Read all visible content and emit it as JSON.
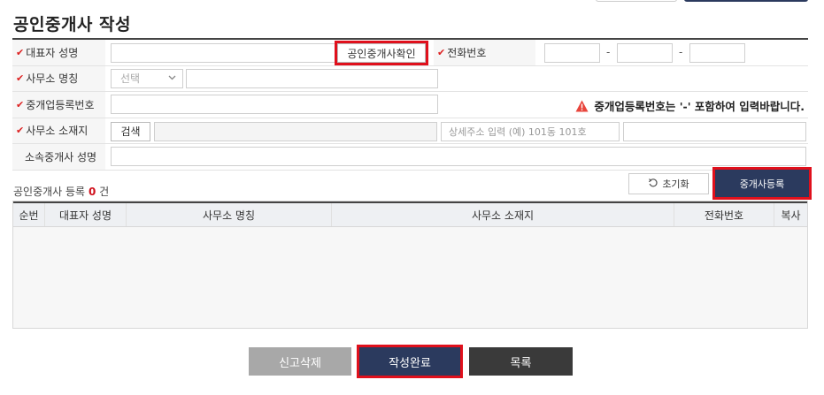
{
  "page": {
    "title": "공인중개사 작성"
  },
  "form": {
    "rep_name_label": "대표자 성명",
    "verify_button": "공인중개사확인",
    "phone_label": "전화번호",
    "phone_sep": "-",
    "office_name_label": "사무소 명칭",
    "office_select_value": "선택",
    "reg_no_label": "중개업등록번호",
    "reg_no_warning": "중개업등록번호는  '-' 포함하여 입력바랍니다.",
    "address_label": "사무소 소재지",
    "search_button": "검색",
    "address_detail_placeholder": "상세주소 입력 (예) 101동 101호",
    "affiliate_label": "소속중개사 성명",
    "required_mark": "✔"
  },
  "list": {
    "count_prefix": "공인중개사 등록",
    "count_value": "0",
    "count_suffix": "건",
    "reset_button": "초기화",
    "register_button": "중개사등록",
    "columns": [
      "순번",
      "대표자 성명",
      "사무소 명칭",
      "사무소 소재지",
      "전화번호",
      "복사"
    ]
  },
  "actions": {
    "delete_label": "신고삭제",
    "complete_label": "작성완료",
    "list_label": "목록"
  }
}
